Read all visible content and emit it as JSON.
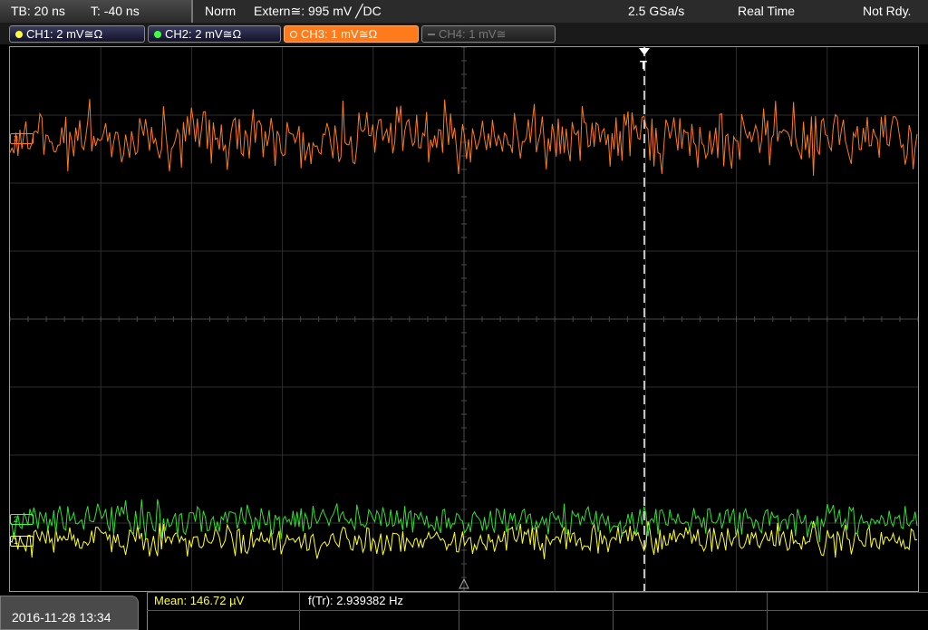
{
  "header": {
    "timebase": "TB: 20 ns",
    "trigger_time": "T: -40 ns",
    "trigger_mode": "Norm",
    "trigger_source": "Extern≅: 995 mV ╱DC",
    "sample_rate": "2.5 GSa/s",
    "acq_mode": "Real Time",
    "status": "Not Rdy."
  },
  "channels": [
    {
      "label": "CH1: 2 mV≅Ω",
      "color": "#ffff40",
      "state": "on"
    },
    {
      "label": "CH2: 2 mV≅Ω",
      "color": "#40ff40",
      "state": "on"
    },
    {
      "label": "CH3: 1 mV≅Ω",
      "color": "#ff7a1a",
      "state": "active"
    },
    {
      "label": "CH4: 1 mV≅",
      "color": "#777777",
      "state": "off"
    }
  ],
  "footer": {
    "datetime": "2016-11-28 13:34",
    "mean": "Mean: 146.72 µV",
    "trigger_freq": "f(Tr): 2.939382 Hz"
  },
  "markers": {
    "trigger_label": "T",
    "ch1": "1",
    "ch2": "2",
    "ch3": "3"
  },
  "colors": {
    "ch1_trace": "#ffff20",
    "ch2_trace": "#30e030",
    "ch3_trace": "#ff7a1a",
    "grid": "#2e2e2e",
    "center_axis": "#4a4a4a"
  }
}
